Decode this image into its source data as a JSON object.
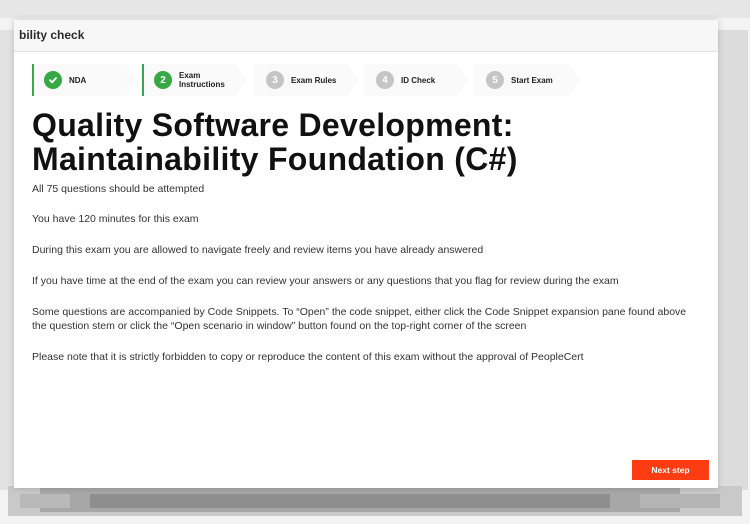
{
  "window": {
    "title": "bility check"
  },
  "stepper": {
    "steps": [
      {
        "number": "✓",
        "label": "NDA",
        "state": "done"
      },
      {
        "number": "2",
        "label": "Exam\nInstructions",
        "state": "active"
      },
      {
        "number": "3",
        "label": "Exam Rules",
        "state": "pending"
      },
      {
        "number": "4",
        "label": "ID Check",
        "state": "pending"
      },
      {
        "number": "5",
        "label": "Start Exam",
        "state": "pending"
      }
    ]
  },
  "main": {
    "title": "Quality Software Development: Maintainability Foundation (C#)",
    "instructions": [
      "All 75 questions should be attempted",
      "You have 120 minutes for this exam",
      "During this exam you are allowed to navigate freely and review items you have already answered",
      "If you have time at the end of the exam you can review your answers or any questions that you flag for review during the exam",
      "Some questions are accompanied by Code Snippets. To “Open” the code snippet, either click the Code Snippet expansion pane found above the question stem or click the “Open scenario in window” button found on the top-right corner of the screen",
      "Please note that it is strictly forbidden to copy or reproduce the content of this exam without the approval of PeopleCert"
    ]
  },
  "footer": {
    "next_label": "Next step"
  },
  "colors": {
    "accent_green": "#36a945",
    "pending_grey": "#c5c5c5",
    "primary_button": "#ff3c12"
  },
  "icons": {
    "done": "check-icon"
  }
}
